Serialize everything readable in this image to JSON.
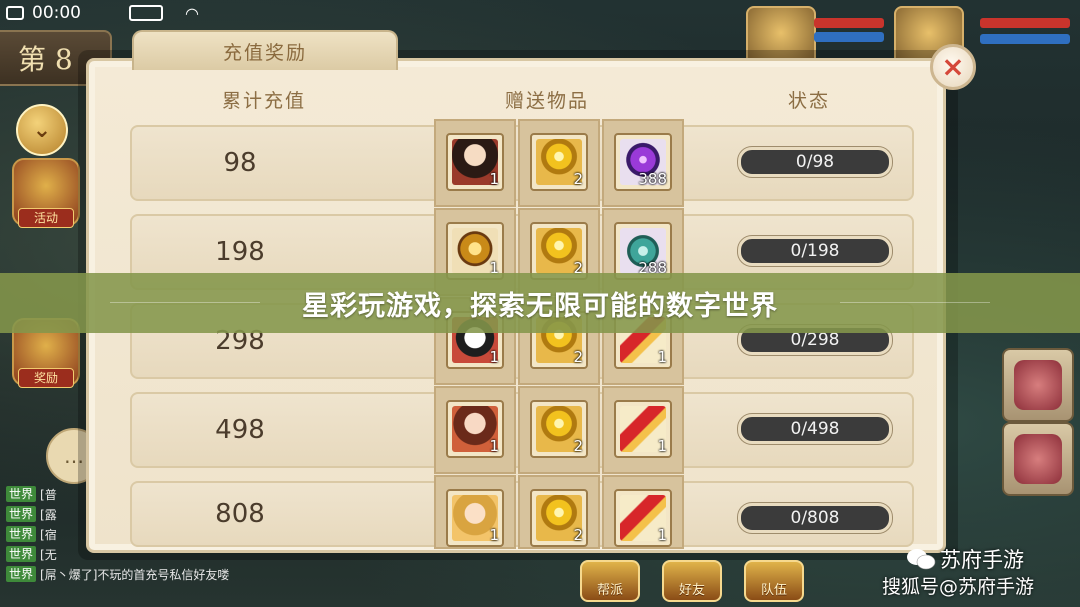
{
  "status_bar": {
    "time": "00:00"
  },
  "chapter": {
    "label": "第 8"
  },
  "side_menu": [
    {
      "label": "活动"
    },
    {
      "label": "奖励"
    }
  ],
  "chat": {
    "lines": [
      {
        "tag": "世界",
        "text": "[普"
      },
      {
        "tag": "世界",
        "text": "[露"
      },
      {
        "tag": "世界",
        "text": "[宿"
      },
      {
        "tag": "世界",
        "text": "[无"
      },
      {
        "tag": "世界",
        "text": "[屌丶爆了]不玩的首充号私信好友喽"
      }
    ]
  },
  "bottom_nav": [
    {
      "label": "帮派"
    },
    {
      "label": "好友"
    },
    {
      "label": "队伍"
    }
  ],
  "dialog": {
    "title": "充值奖励",
    "close_icon": "×",
    "columns": {
      "amount": "累计充值",
      "gifts": "赠送物品",
      "status": "状态"
    },
    "rows": [
      {
        "amount": "98",
        "items": [
          {
            "icon": "hero-portrait",
            "count": "1"
          },
          {
            "icon": "gold-ingot",
            "count": "2"
          },
          {
            "icon": "purple-gem",
            "count": "388"
          }
        ],
        "status": "0/98"
      },
      {
        "amount": "198",
        "items": [
          {
            "icon": "golden-beast",
            "count": "1"
          },
          {
            "icon": "gold-ingot",
            "count": "2"
          },
          {
            "icon": "jade-vase",
            "count": "288"
          }
        ],
        "status": "0/198"
      },
      {
        "amount": "298",
        "items": [
          {
            "icon": "panda",
            "count": "1"
          },
          {
            "icon": "gold-ingot",
            "count": "2"
          },
          {
            "icon": "red-scroll",
            "count": "1"
          }
        ],
        "status": "0/298"
      },
      {
        "amount": "498",
        "items": [
          {
            "icon": "hero-portrait-girl",
            "count": "1"
          },
          {
            "icon": "gold-ingot",
            "count": "2"
          },
          {
            "icon": "red-scroll",
            "count": "1"
          }
        ],
        "status": "0/498"
      },
      {
        "amount": "808",
        "items": [
          {
            "icon": "hero-portrait-blonde",
            "count": "1"
          },
          {
            "icon": "gold-ingot",
            "count": "2"
          },
          {
            "icon": "red-scroll",
            "count": "1"
          }
        ],
        "status": "0/808"
      }
    ]
  },
  "banner": {
    "text": "星彩玩游戏，探索无限可能的数字世界",
    "color": "#84964b"
  },
  "watermark": {
    "line1": "苏府手游",
    "line2": "搜狐号@苏府手游"
  }
}
